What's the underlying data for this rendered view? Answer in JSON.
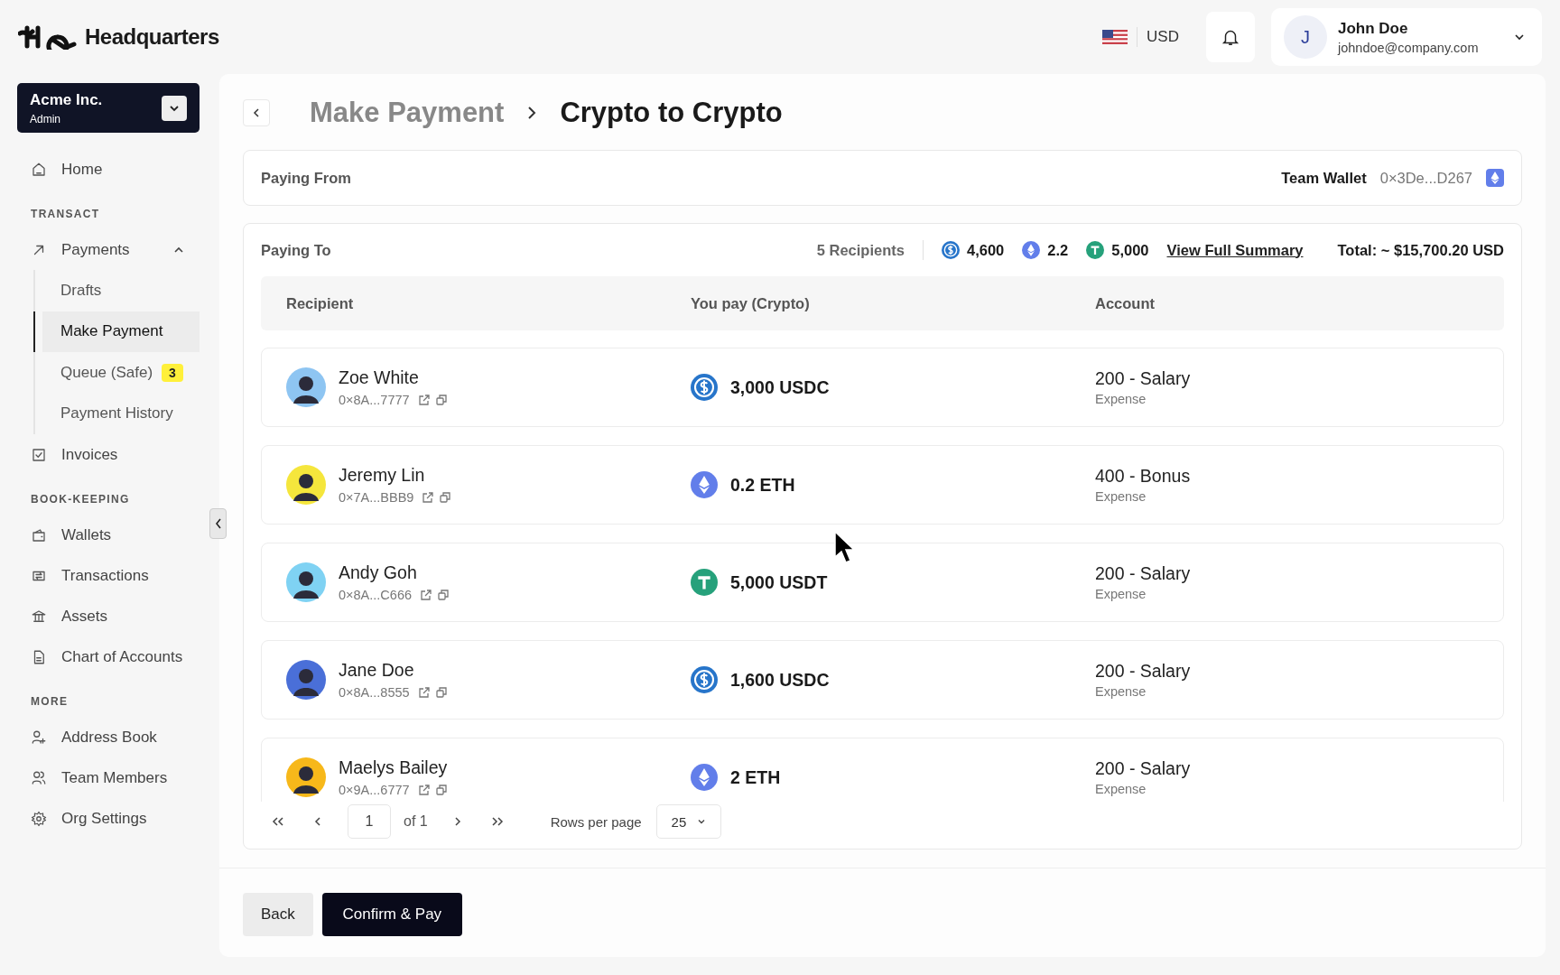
{
  "header": {
    "brand": "Headquarters",
    "currency": "USD",
    "user": {
      "initial": "J",
      "name": "John Doe",
      "email": "johndoe@company.com"
    }
  },
  "sidebar": {
    "org": {
      "name": "Acme Inc.",
      "role": "Admin"
    },
    "nav": [
      {
        "kind": "item",
        "label": "Home",
        "selected": false
      },
      {
        "kind": "section",
        "label": "TRANSACT"
      },
      {
        "kind": "item",
        "label": "Payments",
        "selected": false,
        "expanded": true,
        "children": [
          {
            "label": "Drafts",
            "selected": false
          },
          {
            "label": "Make Payment",
            "selected": true
          },
          {
            "label": "Queue (Safe)",
            "selected": false,
            "badge": "3"
          },
          {
            "label": "Payment History",
            "selected": false
          }
        ]
      },
      {
        "kind": "item",
        "label": "Invoices",
        "selected": false
      },
      {
        "kind": "section",
        "label": "BOOK-KEEPING"
      },
      {
        "kind": "item",
        "label": "Wallets",
        "selected": false
      },
      {
        "kind": "item",
        "label": "Transactions",
        "selected": false
      },
      {
        "kind": "item",
        "label": "Assets",
        "selected": false
      },
      {
        "kind": "item",
        "label": "Chart of Accounts",
        "selected": false
      },
      {
        "kind": "section",
        "label": "MORE"
      },
      {
        "kind": "item",
        "label": "Address Book",
        "selected": false
      },
      {
        "kind": "item",
        "label": "Team Members",
        "selected": false
      },
      {
        "kind": "item",
        "label": "Org Settings",
        "selected": false
      }
    ]
  },
  "breadcrumb": [
    "Make Payment",
    "Crypto to Crypto"
  ],
  "paying_from": {
    "label": "Paying From",
    "wallet_name": "Team Wallet",
    "address": "0×3De...D267",
    "chain": {
      "kind": "eth"
    }
  },
  "paying_to": {
    "label": "Paying To",
    "recipients_count": "5 Recipients",
    "totals": [
      {
        "kind": "usdc",
        "amount": "4,600"
      },
      {
        "kind": "eth",
        "amount": "2.2"
      },
      {
        "kind": "usdt",
        "amount": "5,000"
      }
    ],
    "summary_link": "View Full Summary",
    "total": "Total: ~ $15,700.20 USD"
  },
  "table": {
    "columns": [
      "Recipient",
      "You pay (Crypto)",
      "Account"
    ],
    "rows": [
      {
        "name": "Zoe White",
        "address": "0×8A...7777",
        "color": "#8ec5f2",
        "kind": "usdc",
        "amount": "3,000 USDC",
        "account": "200 - Salary",
        "account_type": "Expense"
      },
      {
        "name": "Jeremy Lin",
        "address": "0×7A...BBB9",
        "color": "#f5e63c",
        "kind": "eth",
        "amount": "0.2 ETH",
        "account": "400 - Bonus",
        "account_type": "Expense"
      },
      {
        "name": "Andy Goh",
        "address": "0×8A...C666",
        "color": "#7fd2f3",
        "kind": "usdt",
        "amount": "5,000 USDT",
        "account": "200 - Salary",
        "account_type": "Expense"
      },
      {
        "name": "Jane Doe",
        "address": "0×8A...8555",
        "color": "#4a6fd8",
        "kind": "usdc",
        "amount": "1,600 USDC",
        "account": "200 - Salary",
        "account_type": "Expense"
      },
      {
        "name": "Maelys Bailey",
        "address": "0×9A...6777",
        "color": "#f7b81a",
        "kind": "eth",
        "amount": "2 ETH",
        "account": "200 - Salary",
        "account_type": "Expense"
      }
    ]
  },
  "pagination": {
    "page": "1",
    "of": "of 1",
    "rows_label": "Rows per page",
    "rows_value": "25"
  },
  "buttons": [
    {
      "kind": "secondary",
      "label": "Back"
    },
    {
      "kind": "primary",
      "label": "Confirm & Pay"
    }
  ]
}
